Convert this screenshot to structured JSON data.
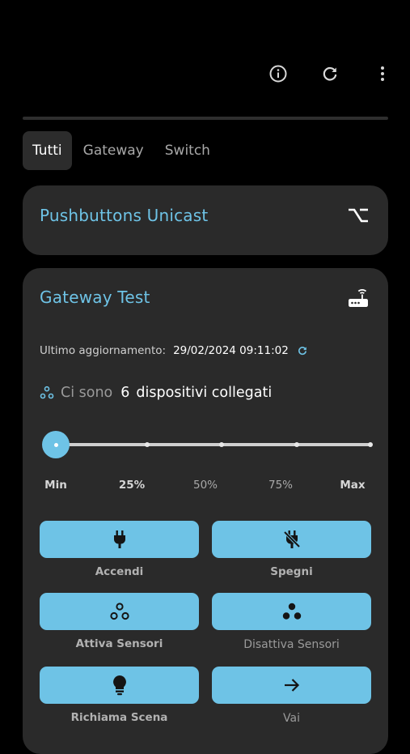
{
  "colors": {
    "accent": "#6ec3e6",
    "card": "#2a2a2a",
    "background": "#000000",
    "button_icon": "#151515"
  },
  "toolbar": {
    "icons": [
      "info-icon",
      "refresh-icon",
      "more-vert-icon"
    ]
  },
  "tabs": [
    {
      "label": "Tutti",
      "active": true
    },
    {
      "label": "Gateway",
      "active": false
    },
    {
      "label": "Switch",
      "active": false
    }
  ],
  "cards": {
    "pushbuttons": {
      "title": "Pushbuttons Unicast",
      "icon": "switch-icon"
    },
    "gateway": {
      "title": "Gateway Test",
      "icon": "router-icon",
      "updated_label": "Ultimo aggiornamento:",
      "updated_value": "29/02/2024 09:11:02",
      "devices_prefix": "Ci sono",
      "devices_count": "6",
      "devices_suffix": "dispositivi collegati",
      "slider": {
        "value": 0,
        "labels": [
          "Min",
          "25%",
          "50%",
          "75%",
          "Max"
        ]
      },
      "actions": [
        {
          "label": "Accendi",
          "icon": "plug-icon"
        },
        {
          "label": "Spegni",
          "icon": "plug-off-icon"
        },
        {
          "label": "Attiva Sensori",
          "icon": "sensors-outline-icon"
        },
        {
          "label": "Disattiva Sensori",
          "icon": "sensors-filled-icon"
        },
        {
          "label": "Richiama Scena",
          "icon": "lightbulb-icon"
        },
        {
          "label": "Vai",
          "icon": "arrow-right-icon"
        }
      ]
    }
  }
}
